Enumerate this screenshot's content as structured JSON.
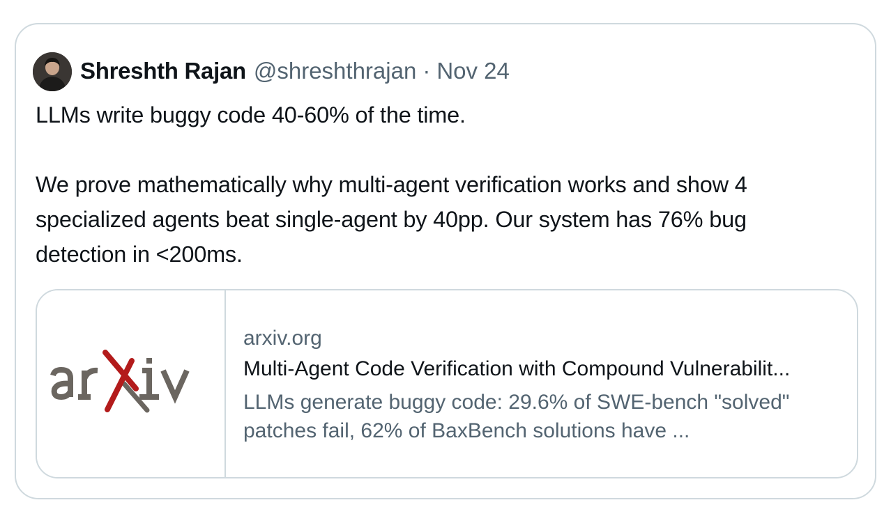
{
  "tweet": {
    "author_name": "Shreshth Rajan",
    "handle": "@shreshthrajan",
    "separator": "·",
    "date": "Nov 24",
    "paragraphs": [
      "LLMs write buggy code 40-60% of the time.",
      "We prove mathematically why multi-agent verification works and show 4",
      "specialized agents beat single-agent by 40pp. Our system has 76% bug",
      "detection in <200ms."
    ]
  },
  "link_card": {
    "domain": "arxiv.org",
    "title": "Multi-Agent Code Verification with Compound Vulnerabilit...",
    "description_lines": [
      "LLMs generate buggy code: 29.6% of SWE-bench \"solved\"",
      "patches fail, 62% of BaxBench solutions have ..."
    ],
    "thumbnail_logo": "arxiv",
    "logo_text_color": "#6b6660",
    "logo_x_color": "#b31b1b"
  },
  "colors": {
    "primary_text": "#0f1419",
    "secondary_text": "#536471",
    "border": "#cfd9de"
  }
}
